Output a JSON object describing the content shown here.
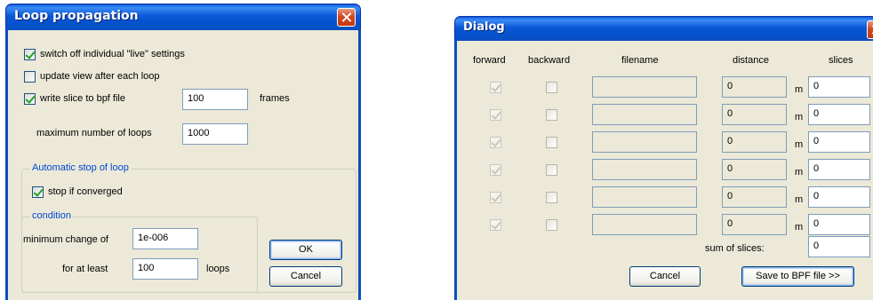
{
  "loop": {
    "title": "Loop propagation",
    "switch_off_live_label": "switch off individual \"live\" settings",
    "update_view_label": "update view after each loop",
    "write_slice_label": "write slice to bpf file",
    "write_slice_value": "100",
    "frames_label": "frames",
    "max_loops_label": "maximum number of loops",
    "max_loops_value": "1000",
    "auto_stop_group": "Automatic stop of loop",
    "stop_converged_label": "stop if converged",
    "condition_group": "condition",
    "min_change_label": "minimum change of",
    "min_change_value": "1e-006",
    "for_at_least_label": "for at least",
    "for_at_least_value": "100",
    "loops_label": "loops",
    "ok_label": "OK",
    "cancel_label": "Cancel",
    "checks": {
      "switch_off_live": true,
      "update_view": false,
      "write_slice": true,
      "stop_converged": true
    }
  },
  "dialog": {
    "title": "Dialog",
    "headers": {
      "forward": "forward",
      "backward": "backward",
      "filename": "filename",
      "distance": "distance",
      "slices": "slices"
    },
    "rows": [
      {
        "forward": true,
        "backward": false,
        "filename": "",
        "distance": "0",
        "unit": "m",
        "slices": "0"
      },
      {
        "forward": true,
        "backward": false,
        "filename": "",
        "distance": "0",
        "unit": "m",
        "slices": "0"
      },
      {
        "forward": true,
        "backward": false,
        "filename": "",
        "distance": "0",
        "unit": "m",
        "slices": "0"
      },
      {
        "forward": true,
        "backward": false,
        "filename": "",
        "distance": "0",
        "unit": "m",
        "slices": "0"
      },
      {
        "forward": true,
        "backward": false,
        "filename": "",
        "distance": "0",
        "unit": "m",
        "slices": "0"
      },
      {
        "forward": true,
        "backward": false,
        "filename": "",
        "distance": "0",
        "unit": "m",
        "slices": "0"
      }
    ],
    "sum_label": "sum of slices:",
    "sum_value": "0",
    "cancel_label": "Cancel",
    "save_label": "Save to BPF file >>"
  },
  "colors": {
    "title_bar": "#0a4fc2",
    "client": "#ece9d8",
    "group_title": "#0046d5",
    "check": "#21a121"
  }
}
